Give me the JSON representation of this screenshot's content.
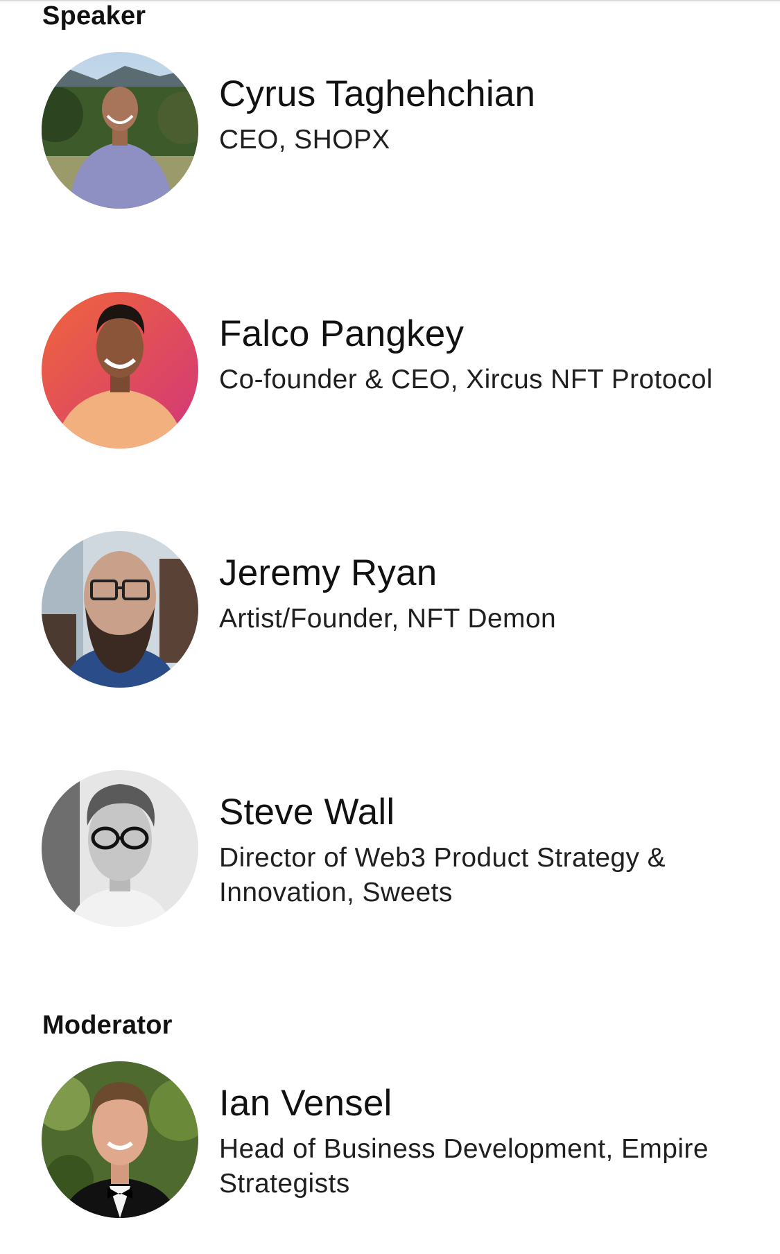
{
  "sections": {
    "speaker_title": "Speaker",
    "moderator_title": "Moderator"
  },
  "speakers": [
    {
      "name": "Cyrus Taghehchian",
      "role": "CEO, SHOPX"
    },
    {
      "name": "Falco Pangkey",
      "role": "Co-founder & CEO, Xircus NFT Protocol"
    },
    {
      "name": "Jeremy Ryan",
      "role": "Artist/Founder, NFT Demon"
    },
    {
      "name": "Steve Wall",
      "role": "Director of Web3 Product Strategy & Innovation, Sweets"
    }
  ],
  "moderators": [
    {
      "name": "Ian Vensel",
      "role": "Head of Business Development, Empire Strategists"
    }
  ],
  "colors": {
    "text_primary": "#111111",
    "text_secondary": "#1f1f1f",
    "avatar_gradient_start": "#f0663a",
    "avatar_gradient_end": "#d2367a"
  },
  "avatar_icons": [
    "person-photo-icon",
    "person-photo-icon",
    "person-photo-icon",
    "person-photo-icon",
    "person-photo-icon"
  ]
}
